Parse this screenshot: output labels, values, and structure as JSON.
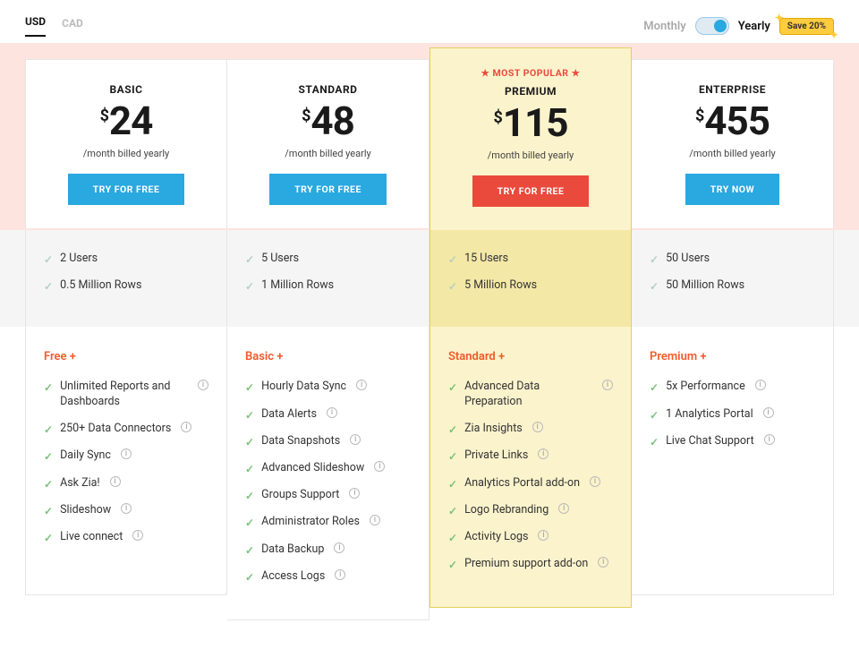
{
  "currency": {
    "usd": "USD",
    "cad": "CAD"
  },
  "billing": {
    "monthly": "Monthly",
    "yearly": "Yearly",
    "save": "Save 20%"
  },
  "popular_label": "★ MOST POPULAR ★",
  "plans": [
    {
      "name": "BASIC",
      "currency": "$",
      "price": "24",
      "period": "/month billed yearly",
      "cta": "TRY FOR FREE",
      "cta_style": "blue",
      "usage": [
        "2 Users",
        "0.5 Million Rows"
      ],
      "inherit": "Free +",
      "features": [
        {
          "t": "Unlimited Reports and Dashboards",
          "i": true
        },
        {
          "t": "250+ Data Connectors",
          "i": true
        },
        {
          "t": "Daily Sync",
          "i": true
        },
        {
          "t": "Ask Zia!",
          "i": true
        },
        {
          "t": "Slideshow",
          "i": true
        },
        {
          "t": "Live connect",
          "i": true
        }
      ]
    },
    {
      "name": "STANDARD",
      "currency": "$",
      "price": "48",
      "period": "/month billed yearly",
      "cta": "TRY FOR FREE",
      "cta_style": "blue",
      "usage": [
        "5 Users",
        "1 Million Rows"
      ],
      "inherit": "Basic +",
      "features": [
        {
          "t": "Hourly Data Sync",
          "i": true
        },
        {
          "t": "Data Alerts",
          "i": true
        },
        {
          "t": "Data Snapshots",
          "i": true
        },
        {
          "t": "Advanced Slideshow",
          "i": true
        },
        {
          "t": "Groups Support",
          "i": true
        },
        {
          "t": "Administrator Roles",
          "i": true
        },
        {
          "t": "Data Backup",
          "i": true
        },
        {
          "t": "Access Logs",
          "i": true
        }
      ]
    },
    {
      "name": "PREMIUM",
      "popular": true,
      "currency": "$",
      "price": "115",
      "period": "/month billed yearly",
      "cta": "TRY FOR FREE",
      "cta_style": "red",
      "usage": [
        "15 Users",
        "5 Million Rows"
      ],
      "inherit": "Standard +",
      "features": [
        {
          "t": "Advanced Data Preparation",
          "i": true
        },
        {
          "t": "Zia Insights",
          "i": true
        },
        {
          "t": "Private Links",
          "i": true
        },
        {
          "t": "Analytics Portal add-on",
          "i": true
        },
        {
          "t": "Logo Rebranding",
          "i": true
        },
        {
          "t": "Activity Logs",
          "i": true
        },
        {
          "t": "Premium support add-on",
          "i": true
        }
      ]
    },
    {
      "name": "ENTERPRISE",
      "currency": "$",
      "price": "455",
      "period": "/month billed yearly",
      "cta": "TRY NOW",
      "cta_style": "blue",
      "usage": [
        "50 Users",
        "50 Million Rows"
      ],
      "inherit": "Premium +",
      "features": [
        {
          "t": "5x Performance",
          "i": true
        },
        {
          "t": "1 Analytics Portal",
          "i": true
        },
        {
          "t": "Live Chat Support",
          "i": true
        }
      ]
    }
  ]
}
